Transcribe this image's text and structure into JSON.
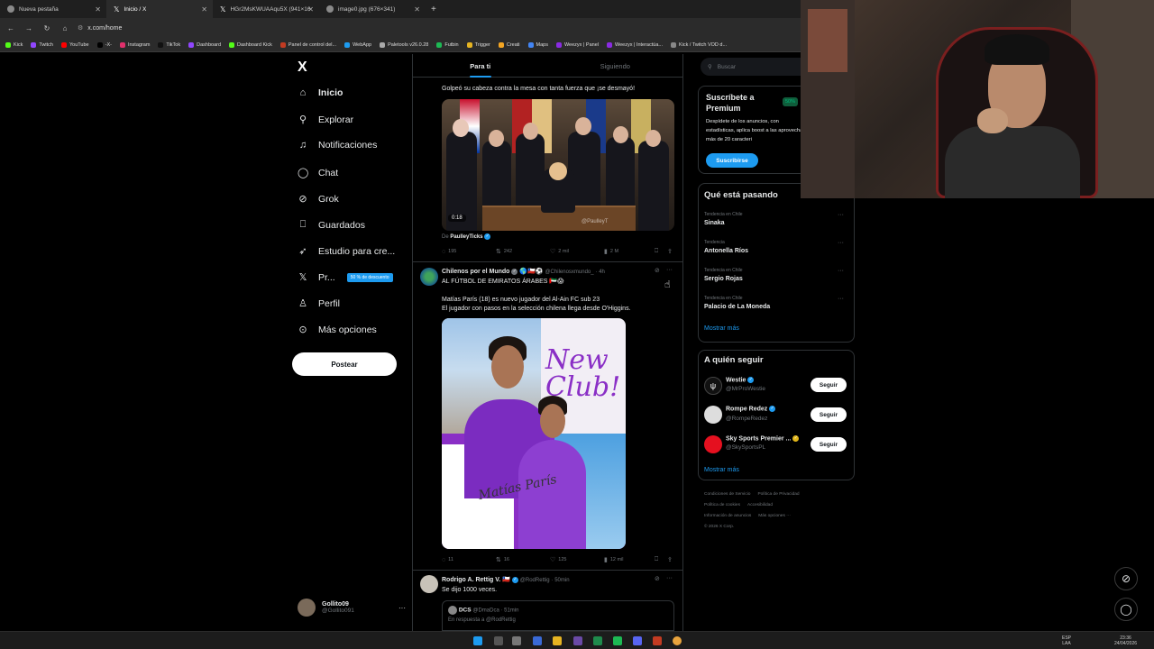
{
  "browser": {
    "tabs": [
      {
        "title": "Nueva pestaña",
        "active": false
      },
      {
        "title": "Inicio / X",
        "active": true
      },
      {
        "title": "HGr2MsKWUAAqu5X (941×16",
        "active": false
      },
      {
        "title": "image0.jpg (676×341)",
        "active": false
      }
    ],
    "url": "x.com/home",
    "bookmarks": [
      "Kick",
      "Twitch",
      "YouTube",
      "-X-",
      "Instagram",
      "TikTok",
      "Dashboard",
      "Dashboard Kick",
      "Panel de control del...",
      "WebApp",
      "Paletools v26.0.28",
      "Futbin",
      "Trigger",
      "Creati",
      "Maps",
      "Weezyx | Panel",
      "Weezyx | Interactúa...",
      "Kick / Twitch VOD d..."
    ]
  },
  "nav": {
    "logo": "X",
    "items": [
      {
        "label": "Inicio",
        "icon": "home-icon"
      },
      {
        "label": "Explorar",
        "icon": "search-icon"
      },
      {
        "label": "Notificaciones",
        "icon": "bell-icon"
      },
      {
        "label": "Chat",
        "icon": "chat-icon"
      },
      {
        "label": "Grok",
        "icon": "grok-icon"
      },
      {
        "label": "Guardados",
        "icon": "bookmark-icon"
      },
      {
        "label": "Estudio para cre...",
        "icon": "rocket-icon"
      },
      {
        "label": "Pr...",
        "icon": "x-premium-icon"
      },
      {
        "label": "Perfil",
        "icon": "person-icon"
      },
      {
        "label": "Más opciones",
        "icon": "more-circle-icon"
      }
    ],
    "premium_badge": "50 % de descuento",
    "post_button": "Postear",
    "account": {
      "name": "Gollito09",
      "handle": "@Gollito091"
    }
  },
  "feed": {
    "tabs": [
      "Para ti",
      "Siguiendo"
    ],
    "tweet1": {
      "text": "Golpeó su cabeza contra la mesa con tanta fuerza que ¡se desmayó!",
      "video_time": "0:18",
      "watermark": "@PaulleyT",
      "from_prefix": "De",
      "from_name": "PaulleyTicks",
      "replies": "195",
      "retweets": "242",
      "likes": "2 mil",
      "views": "2 M"
    },
    "tweet2": {
      "name": "Chilenos por el Mundo",
      "emojis": "🌎🇨🇱⚽",
      "handle": "@Chilenosxmundo_",
      "time": "· 4h",
      "line1": "AL FÚTBOL DE EMIRATOS ÁRABES 🇦🇪😱",
      "line2": "Matías París (18) es nuevo jugador del Al-Ain FC sub 23",
      "line3": "El jugador con pasos en la selección chilena llega desde O'Higgins.",
      "image_text1": "New",
      "image_text2": "Club!",
      "image_signature": "Matías París",
      "replies": "11",
      "retweets": "16",
      "likes": "125",
      "views": "12 mil"
    },
    "tweet3": {
      "name": "Rodrigo A. Rettig V.",
      "handle": "@RodRettig",
      "time": "· 50min",
      "text": "Se dijo 1000 veces.",
      "quote_name": "DCS",
      "quote_handle": "@DmaDca · 51min",
      "quote_reply": "En respuesta a @RodRettig"
    }
  },
  "sidebar": {
    "search_placeholder": "Buscar",
    "premium": {
      "title": "Suscríbete a Premium",
      "badge": "50%",
      "desc": "Despídete de los anuncios, con estadísticas, aplica boost a las aprovecha más de 20 caracteri",
      "button": "Suscribirse"
    },
    "trends_title": "Qué está pasando",
    "trends": [
      {
        "category": "Tendencia en Chile",
        "name": "Sinaka"
      },
      {
        "category": "Tendencia",
        "name": "Antonella Ríos"
      },
      {
        "category": "Tendencia en Chile",
        "name": "Sergio Rojas"
      },
      {
        "category": "Tendencia en Chile",
        "name": "Palacio de La Moneda"
      }
    ],
    "show_more": "Mostrar más",
    "follow_title": "A quién seguir",
    "follow": [
      {
        "name": "Westie",
        "handle": "@MrProWestie",
        "button": "Seguir"
      },
      {
        "name": "Rompe Redez",
        "handle": "@RompeRedez",
        "button": "Seguir"
      },
      {
        "name": "Sky Sports Premier ...",
        "handle": "@SkySportsPL",
        "button": "Seguir"
      }
    ],
    "follow_show_more": "Mostrar más",
    "footer": [
      "Condiciones de Servicio",
      "Política de Privacidad",
      "Política de cookies",
      "Accesibilidad",
      "Información de anuncios",
      "Más opciones ···",
      "© 2026 X Corp."
    ]
  },
  "taskbar": {
    "lang": "ESP",
    "lang2": "LAA",
    "time": "23:36",
    "date": "24/04/2026"
  },
  "colors": {
    "accent": "#1d9bf0",
    "bg": "#000000",
    "border": "#2f3336",
    "muted": "#71767b"
  }
}
